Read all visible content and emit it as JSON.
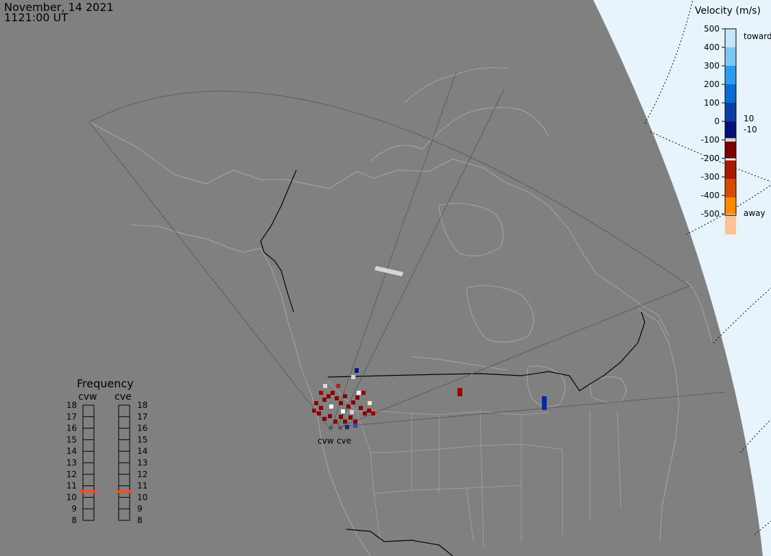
{
  "header": {
    "date": "November, 14 2021",
    "time": "1121:00 UT"
  },
  "map": {
    "land_color": "#808080",
    "space_color": "#e8f4fb",
    "coast_color": "#a6a6a6",
    "border_color": "#000000",
    "fov_color": "#5c5c5c"
  },
  "radars": [
    {
      "code": "cvw"
    },
    {
      "code": "cve"
    }
  ],
  "velocity_scale": {
    "title": "Velocity (m/s)",
    "ticks": [
      "500",
      "400",
      "300",
      "200",
      "100",
      "0",
      "-100",
      "-200",
      "-300",
      "-400",
      "-500"
    ],
    "toward_label": "toward",
    "away_label": "away",
    "near_zero_pos": "10",
    "near_zero_neg": "-10",
    "colors": {
      "toward": [
        "#c4e6fb",
        "#7cc8f5",
        "#2b9cf0",
        "#0b6cd2",
        "#0a3ea6",
        "#03127a"
      ],
      "away": [
        "#7a0000",
        "#a51a00",
        "#d84a00",
        "#ff8a00",
        "#ffc290",
        "#fde2c6"
      ],
      "near_zero": "#d6d6d6"
    }
  },
  "frequency_panel": {
    "title": "Frequency",
    "columns": [
      "cvw",
      "cve"
    ],
    "ticks": [
      "18",
      "17",
      "16",
      "15",
      "14",
      "13",
      "12",
      "11",
      "10",
      "9",
      "8"
    ],
    "cvw_mhz": 10.5,
    "cve_mhz": 10.5,
    "marker_color": "#ff4a1a"
  }
}
